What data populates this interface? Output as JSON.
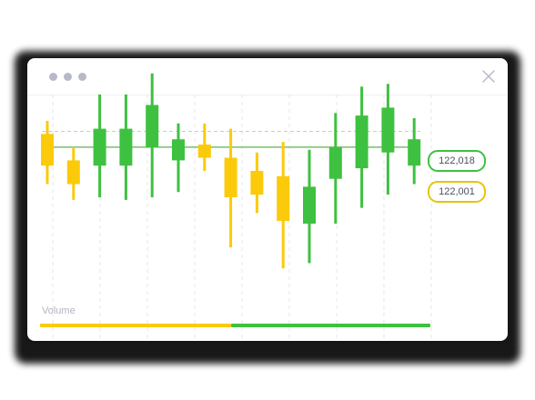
{
  "window": {
    "controls": [
      "traffic-dot-icon",
      "traffic-dot-icon",
      "traffic-dot-icon"
    ],
    "close_icon": "close-icon"
  },
  "colors": {
    "up": "#3ec140",
    "down": "#fbca0a",
    "grid": "#e6e7ee",
    "price_line": "#5ab34d",
    "ref_line": "#c9cbd6"
  },
  "volume": {
    "label": "Volume",
    "down_share": 0.49,
    "up_share": 0.51
  },
  "price_tags": [
    {
      "value": "122,018",
      "color": "#3ec140"
    },
    {
      "value": "122,001",
      "color": "#e5c50e"
    }
  ],
  "chart_data": {
    "type": "candlestick",
    "title": "",
    "xlabel": "",
    "ylabel": "",
    "ylim": [
      121960,
      122040
    ],
    "grid": true,
    "reference_lines": [
      122010,
      122004
    ],
    "candles": [
      {
        "open": 122009,
        "close": 121997,
        "high": 122014,
        "low": 121990,
        "direction": "down"
      },
      {
        "open": 121999,
        "close": 121990,
        "high": 122004,
        "low": 121984,
        "direction": "down"
      },
      {
        "open": 121997,
        "close": 122011,
        "high": 122024,
        "low": 121985,
        "direction": "up"
      },
      {
        "open": 121997,
        "close": 122011,
        "high": 122024,
        "low": 121984,
        "direction": "up"
      },
      {
        "open": 122004,
        "close": 122020,
        "high": 122032,
        "low": 121985,
        "direction": "up"
      },
      {
        "open": 121999,
        "close": 122007,
        "high": 122013,
        "low": 121987,
        "direction": "up"
      },
      {
        "open": 122005,
        "close": 122000,
        "high": 122013,
        "low": 121995,
        "direction": "down"
      },
      {
        "open": 122000,
        "close": 121985,
        "high": 122011,
        "low": 121966,
        "direction": "down"
      },
      {
        "open": 121995,
        "close": 121986,
        "high": 122002,
        "low": 121979,
        "direction": "down"
      },
      {
        "open": 121993,
        "close": 121976,
        "high": 122006,
        "low": 121958,
        "direction": "down"
      },
      {
        "open": 121975,
        "close": 121989,
        "high": 122003,
        "low": 121960,
        "direction": "up"
      },
      {
        "open": 121992,
        "close": 122004,
        "high": 122017,
        "low": 121975,
        "direction": "up"
      },
      {
        "open": 121996,
        "close": 122016,
        "high": 122027,
        "low": 121981,
        "direction": "up"
      },
      {
        "open": 122002,
        "close": 122019,
        "high": 122028,
        "low": 121986,
        "direction": "up"
      },
      {
        "open": 121997,
        "close": 122007,
        "high": 122015,
        "low": 121990,
        "direction": "up"
      }
    ]
  }
}
